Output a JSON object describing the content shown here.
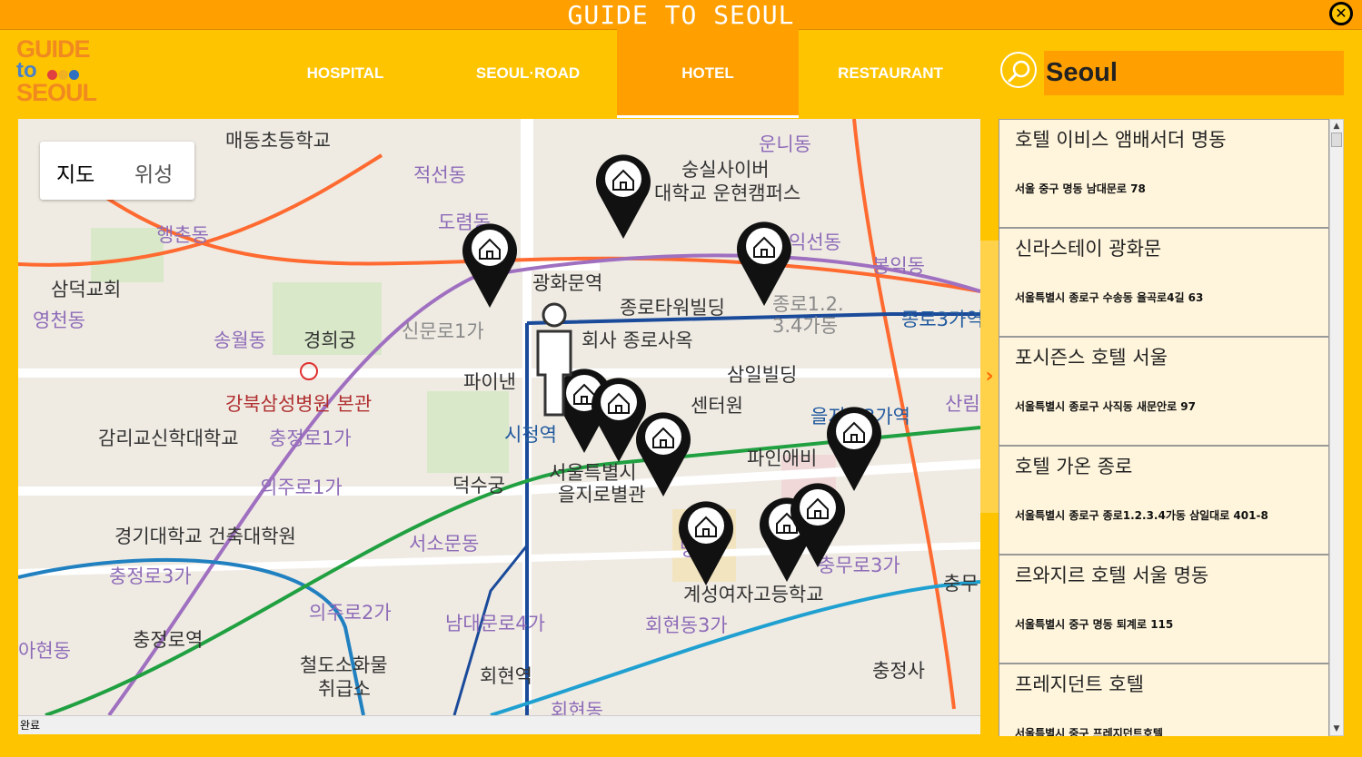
{
  "window": {
    "title": "GUIDE TO SEOUL",
    "close_icon": "close-icon"
  },
  "logo": {
    "line1": "GUIDE",
    "line2": "to",
    "line3": "SEOUL"
  },
  "nav": {
    "tabs": [
      {
        "label": "HOSPITAL",
        "active": false
      },
      {
        "label": "SEOUL·ROAD",
        "active": false
      },
      {
        "label": "HOTEL",
        "active": true
      },
      {
        "label": "RESTAURANT",
        "active": false
      }
    ]
  },
  "search": {
    "value": "Seoul",
    "icon": "search-icon"
  },
  "map": {
    "type_toggle": {
      "map": "지도",
      "satellite": "위성"
    },
    "labels": [
      "매동초등학교",
      "숭실사이버",
      "대학교 운현캠퍼스",
      "운니동",
      "적선동",
      "도렴동",
      "행촌동",
      "익선동",
      "봉익동",
      "광화문역",
      "삼덕교회",
      "종로타워빌딩",
      "종로1.2.",
      "3.4가동",
      "종로3가역",
      "영천동",
      "경희궁",
      "송월동",
      "신문로1가",
      "회사 종로사옥",
      "파이낸",
      "삼일빌딩",
      "강북삼성병원 본관",
      "센터원",
      "을지로3가역",
      "산림",
      "감리교신학대학교",
      "충정로1가",
      "시청역",
      "덕수궁",
      "서울특별시",
      "을지로별관",
      "파인애비",
      "의주로1가",
      "경기대학교 건축대학원",
      "서소문동",
      "충정로3가",
      "명동",
      "충무로3가",
      "충무",
      "계성여자고등학교",
      "의주로2가",
      "남대문로4가",
      "회현동3가",
      "충정로역",
      "아현동",
      "철도소화물",
      "취급소",
      "회현역",
      "충정사",
      "회현동"
    ],
    "status": "완료"
  },
  "hotels": [
    {
      "name": "호텔 이비스 앰배서더 명동",
      "address": "서울 중구 명동 남대문로 78"
    },
    {
      "name": "신라스테이 광화문",
      "address": "서울특별시 종로구 수송동 율곡로4길 63"
    },
    {
      "name": "포시즌스 호텔 서울",
      "address": "서울특별시 종로구 사직동 새문안로 97"
    },
    {
      "name": "호텔 가온 종로",
      "address": "서울특별시 종로구 종로1.2.3.4가동 삼일대로 401-8"
    },
    {
      "name": "르와지르 호텔 서울 명동",
      "address": "서울특별시 중구 명동 퇴계로 115"
    },
    {
      "name": "프레지던트 호텔",
      "address": "서울특별시 중구 프레지던트호텔"
    }
  ],
  "colors": {
    "header": "#ff9f00",
    "background": "#ffc400",
    "list_item": "#fff5dc",
    "accent_text": "#ffffff"
  },
  "side_toggle": "›"
}
